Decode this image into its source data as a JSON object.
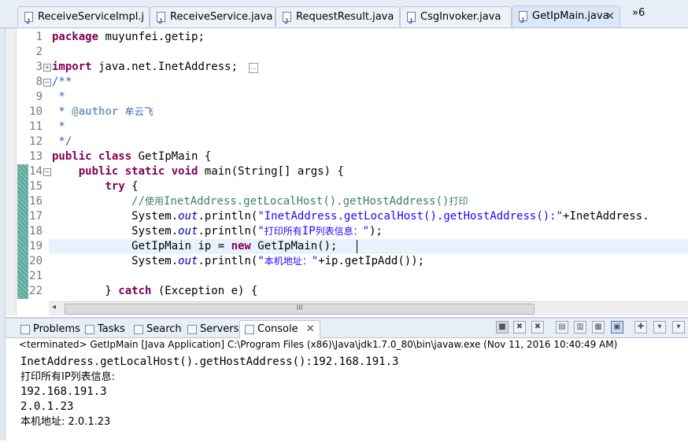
{
  "editor_tabs": [
    {
      "label": "ReceiveServiceImpl.j",
      "active": false
    },
    {
      "label": "ReceiveService.java",
      "active": false
    },
    {
      "label": "RequestResult.java",
      "active": false
    },
    {
      "label": "CsgInvoker.java",
      "active": false
    },
    {
      "label": "GetIpMain.java",
      "active": true
    }
  ],
  "overflow_label": "»6",
  "editor": {
    "current_line": 19,
    "lines": [
      {
        "n": "1",
        "text": "package muyunfei.getip;"
      },
      {
        "n": "2",
        "text": ""
      },
      {
        "n": "3",
        "text": "import java.net.InetAddress;"
      },
      {
        "n": "8",
        "text": "/**"
      },
      {
        "n": "9",
        "text": " *"
      },
      {
        "n": "10",
        "text": " * @author 牟云飞"
      },
      {
        "n": "11",
        "text": " *"
      },
      {
        "n": "12",
        "text": " */"
      },
      {
        "n": "13",
        "text": "public class GetIpMain {"
      },
      {
        "n": "14",
        "text": "    public static void main(String[] args) {"
      },
      {
        "n": "15",
        "text": "        try {"
      },
      {
        "n": "16",
        "text": "            //使用InetAddress.getLocalHost().getHostAddress()打印"
      },
      {
        "n": "17",
        "text": "            System.out.println(\"InetAddress.getLocalHost().getHostAddress():\"+InetAddress."
      },
      {
        "n": "18",
        "text": "            System.out.println(\"打印所有IP列表信息：\");"
      },
      {
        "n": "19",
        "text": "            GetIpMain ip = new GetIpMain();"
      },
      {
        "n": "20",
        "text": "            System.out.println(\"本机地址：\"+ip.getIpAdd());"
      },
      {
        "n": "21",
        "text": ""
      },
      {
        "n": "22",
        "text": "        } catch (Exception e) {"
      }
    ]
  },
  "panel_tabs": [
    {
      "label": "Problems",
      "icon": "problems-icon"
    },
    {
      "label": "Tasks",
      "icon": "tasks-icon"
    },
    {
      "label": "Search",
      "icon": "search-icon"
    },
    {
      "label": "Servers",
      "icon": "servers-icon"
    },
    {
      "label": "Console",
      "icon": "console-icon",
      "active": true
    }
  ],
  "console": {
    "status": "<terminated> GetIpMain [Java Application] C:\\Program Files (x86)\\Java\\jdk1.7.0_80\\bin\\javaw.exe (Nov 11, 2016 10:40:49 AM)",
    "output": [
      "InetAddress.getLocalHost().getHostAddress():192.168.191.3",
      "打印所有IP列表信息:",
      "192.168.191.3",
      "2.0.1.23",
      "本机地址: 2.0.1.23"
    ]
  },
  "scroll_thumb_label": "III",
  "colors": {
    "keyword": "#7f0055",
    "comment": "#3f7f5f",
    "javadoc": "#3f5fbf",
    "string": "#2a00ff",
    "field": "#0000c0"
  }
}
